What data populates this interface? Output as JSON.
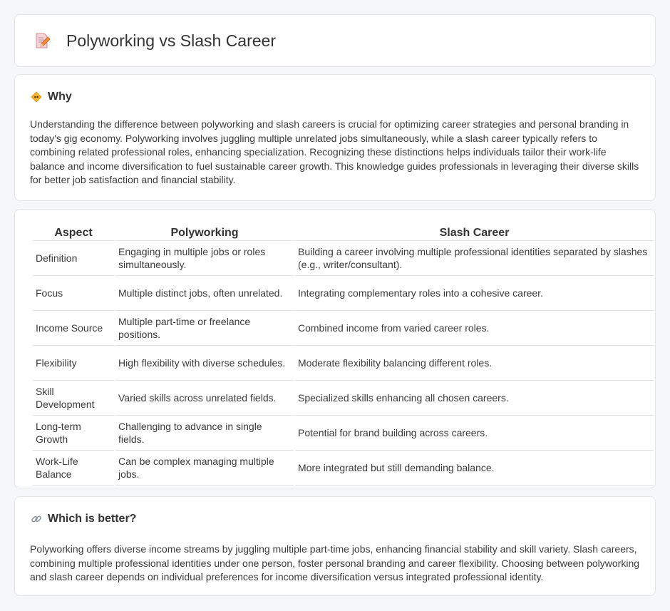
{
  "page": {
    "title": "Polyworking vs Slash Career"
  },
  "why": {
    "icon": "diamond-warning-icon",
    "title": "Why",
    "text": "Understanding the difference between polyworking and slash careers is crucial for optimizing career strategies and personal branding in today's gig economy. Polyworking involves juggling multiple unrelated jobs simultaneously, while a slash career typically refers to combining related professional roles, enhancing specialization. Recognizing these distinctions helps individuals tailor their work-life balance and income diversification to fuel sustainable career growth. This knowledge guides professionals in leveraging their diverse skills for better job satisfaction and financial stability."
  },
  "table": {
    "headers": [
      "Aspect",
      "Polyworking",
      "Slash Career"
    ],
    "rows": [
      [
        "Definition",
        "Engaging in multiple jobs or roles simultaneously.",
        "Building a career involving multiple professional identities separated by slashes (e.g., writer/consultant)."
      ],
      [
        "Focus",
        "Multiple distinct jobs, often unrelated.",
        "Integrating complementary roles into a cohesive career."
      ],
      [
        "Income Source",
        "Multiple part-time or freelance positions.",
        "Combined income from varied career roles."
      ],
      [
        "Flexibility",
        "High flexibility with diverse schedules.",
        "Moderate flexibility balancing different roles."
      ],
      [
        "Skill Development",
        "Varied skills across unrelated fields.",
        "Specialized skills enhancing all chosen careers."
      ],
      [
        "Long-term Growth",
        "Challenging to advance in single fields.",
        "Potential for brand building across careers."
      ],
      [
        "Work-Life Balance",
        "Can be complex managing multiple jobs.",
        "More integrated but still demanding balance."
      ]
    ]
  },
  "better": {
    "icon": "link-icon",
    "title": "Which is better?",
    "text": "Polyworking offers diverse income streams by juggling multiple part-time jobs, enhancing financial stability and skill variety. Slash careers, combining multiple professional identities under one person, foster personal branding and career flexibility. Choosing between polyworking and slash career depends on individual preferences for income diversification versus integrated professional identity."
  },
  "colors": {
    "accent_orange": "#f0a020",
    "doc_icon_pink": "#e8a0a8",
    "pencil_orange": "#e86a2a"
  }
}
